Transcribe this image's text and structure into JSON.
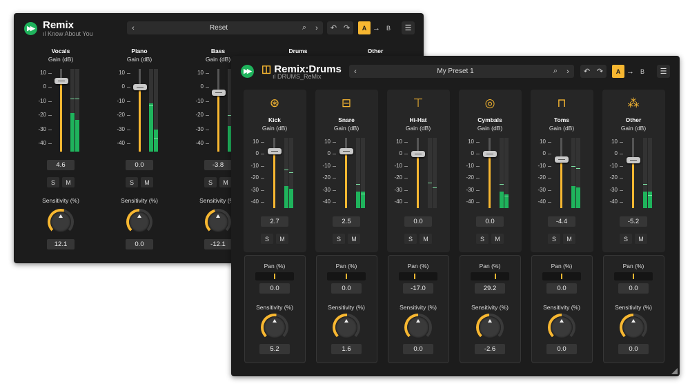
{
  "win1": {
    "title": "Remix",
    "subtitle": "Know About You",
    "preset": "Reset",
    "ab": {
      "a": "A",
      "b": "B"
    },
    "channels": [
      {
        "name": "Vocals",
        "gain_label": "Gain (dB)",
        "value": "4.6",
        "level": 4.6,
        "meter": [
          -40,
          -50
        ],
        "peaks": [
          -8,
          -8
        ],
        "sens_label": "Sensitivity (%)",
        "sens": "12.1",
        "sens_frac": 0.56,
        "solo": "S",
        "mute": "M"
      },
      {
        "name": "Piano",
        "gain_label": "Gain (dB)",
        "value": "0.0",
        "level": 0,
        "meter": [
          -25,
          -65
        ],
        "peaks": [
          -13,
          -36
        ],
        "sens_label": "Sensitivity (%)",
        "sens": "0.0",
        "sens_frac": 0.5,
        "solo": "S",
        "mute": "M"
      },
      {
        "name": "Bass",
        "gain_label": "Gain (dB)",
        "value": "-3.8",
        "level": -3.8,
        "meter": [
          -60,
          -55
        ],
        "peaks": [
          -20,
          -16
        ],
        "sens_label": "Sensitivity (%)",
        "sens": "-12.1",
        "sens_frac": 0.44,
        "solo": "S",
        "mute": "M"
      }
    ],
    "extra_headers": [
      "Drums",
      "Other"
    ],
    "scale": [
      "10",
      "0",
      "-10",
      "-20",
      "-30",
      "-40"
    ]
  },
  "win2": {
    "title": "Remix:Drums",
    "subtitle": "DRUMS_ReMix",
    "preset": "My Preset 1",
    "ab": {
      "a": "A",
      "b": "B"
    },
    "scale": [
      "10",
      "0",
      "-10",
      "-20",
      "-30",
      "-40"
    ],
    "channels": [
      {
        "name": "Kick",
        "icon": "kick-drum-icon",
        "gain_label": "Gain (dB)",
        "value": "2.7",
        "level": 2.7,
        "meter": [
          -60,
          -65
        ],
        "peaks": [
          -13,
          -15
        ],
        "solo": "S",
        "mute": "M",
        "pan_label": "Pan (%)",
        "pan": "0.0",
        "pan_frac": 0.5,
        "sens_label": "Sensitivity (%)",
        "sens": "5.2",
        "sens_frac": 0.53
      },
      {
        "name": "Snare",
        "icon": "snare-drum-icon",
        "gain_label": "Gain (dB)",
        "value": "2.5",
        "level": 2.5,
        "meter": [
          -70,
          -70
        ],
        "peaks": [
          -25,
          -33
        ],
        "solo": "S",
        "mute": "M",
        "pan_label": "Pan (%)",
        "pan": "0.0",
        "pan_frac": 0.5,
        "sens_label": "Sensitivity (%)",
        "sens": "1.6",
        "sens_frac": 0.51
      },
      {
        "name": "Hi-Hat",
        "icon": "hi-hat-icon",
        "gain_label": "Gain (dB)",
        "value": "0.0",
        "level": 0,
        "meter": [
          -100,
          -100
        ],
        "peaks": [
          -24,
          -28
        ],
        "solo": "S",
        "mute": "M",
        "pan_label": "Pan (%)",
        "pan": "-17.0",
        "pan_frac": 0.41,
        "sens_label": "Sensitivity (%)",
        "sens": "0.0",
        "sens_frac": 0.5
      },
      {
        "name": "Cymbals",
        "icon": "cymbals-icon",
        "gain_label": "Gain (dB)",
        "value": "0.0",
        "level": 0,
        "meter": [
          -70,
          -75
        ],
        "peaks": [
          -25,
          -35
        ],
        "solo": "S",
        "mute": "M",
        "pan_label": "Pan (%)",
        "pan": "29.2",
        "pan_frac": 0.65,
        "sens_label": "Sensitivity (%)",
        "sens": "-2.6",
        "sens_frac": 0.49
      },
      {
        "name": "Toms",
        "icon": "toms-icon",
        "gain_label": "Gain (dB)",
        "value": "-4.4",
        "level": -4.4,
        "meter": [
          -60,
          -62
        ],
        "peaks": [
          -10,
          -12
        ],
        "solo": "S",
        "mute": "M",
        "pan_label": "Pan (%)",
        "pan": "0.0",
        "pan_frac": 0.5,
        "sens_label": "Sensitivity (%)",
        "sens": "0.0",
        "sens_frac": 0.5
      },
      {
        "name": "Other",
        "icon": "other-percussion-icon",
        "gain_label": "Gain (dB)",
        "value": "-5.2",
        "level": -5.2,
        "meter": [
          -70,
          -70
        ],
        "peaks": [
          -25,
          -34
        ],
        "solo": "S",
        "mute": "M",
        "pan_label": "Pan (%)",
        "pan": "0.0",
        "pan_frac": 0.5,
        "sens_label": "Sensitivity (%)",
        "sens": "0.0",
        "sens_frac": 0.5
      }
    ]
  },
  "colors": {
    "accent": "#f7b731",
    "meter": "#1fb35c",
    "logo": "#1fb35c",
    "bg": "#1c1c1c"
  }
}
